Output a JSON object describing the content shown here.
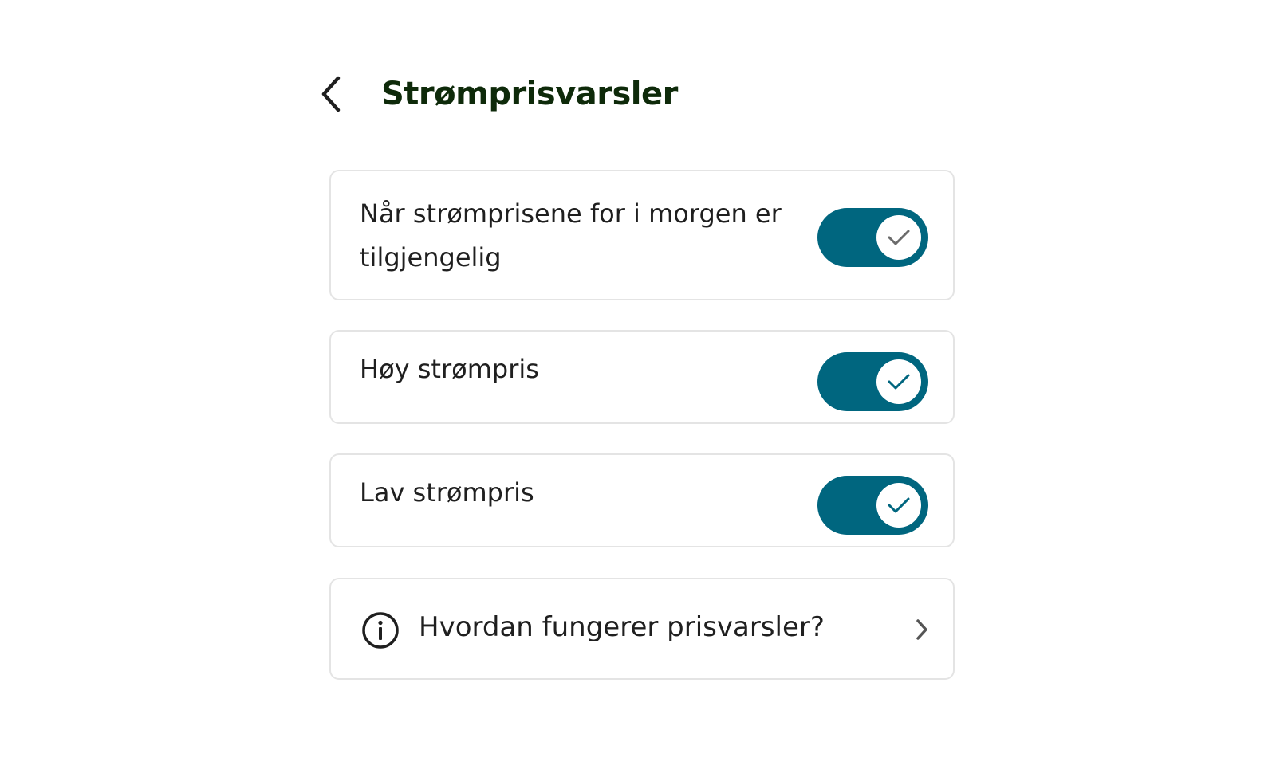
{
  "header": {
    "title": "Strømprisvarsler",
    "back_icon": "chevron-left-icon"
  },
  "settings": [
    {
      "label": "Når strømprisene for i morgen er tilgjengelig",
      "enabled": true,
      "check_color": "#6b6b6b"
    },
    {
      "label": "Høy strømpris",
      "enabled": true,
      "check_color": "#00667f"
    },
    {
      "label": "Lav strømpris",
      "enabled": true,
      "check_color": "#00667f"
    }
  ],
  "info_link": {
    "label": "Hvordan fungerer prisvarsler?",
    "icon": "info-icon",
    "chevron": "chevron-right-icon"
  },
  "colors": {
    "accent": "#00667f",
    "title": "#0e2a0a",
    "border": "#e4e4e4"
  }
}
